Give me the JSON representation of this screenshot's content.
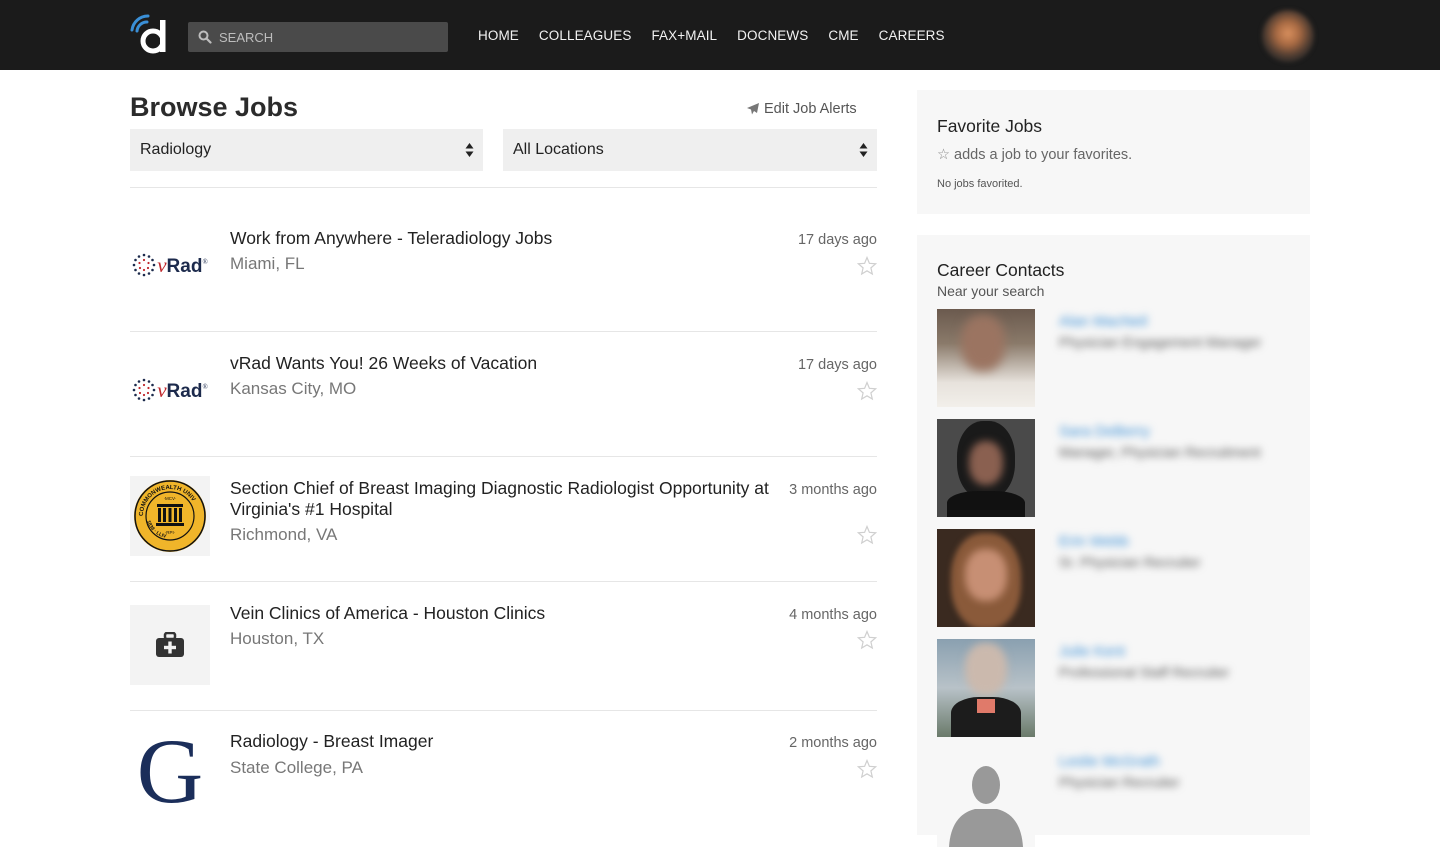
{
  "header": {
    "search_placeholder": "SEARCH",
    "nav": [
      "HOME",
      "COLLEAGUES",
      "FAX+MAIL",
      "DOCNEWS",
      "CME",
      "CAREERS"
    ]
  },
  "main": {
    "title": "Browse Jobs",
    "edit_alerts": "Edit Job Alerts",
    "specialty_filter": "Radiology",
    "location_filter": "All Locations",
    "jobs": [
      {
        "title": "Work from Anywhere - Teleradiology Jobs",
        "location": "Miami, FL",
        "posted": "17 days ago",
        "logo": "vrad-logo"
      },
      {
        "title": "vRad Wants You! 26 Weeks of Vacation",
        "location": "Kansas City, MO",
        "posted": "17 days ago",
        "logo": "vrad-logo"
      },
      {
        "title": "Section Chief of Breast Imaging Diagnostic Radiologist Opportunity at Virginia's #1 Hospital",
        "location": "Richmond, VA",
        "posted": "3 months ago",
        "logo": "vcu-seal-logo"
      },
      {
        "title": "Vein Clinics of America - Houston Clinics",
        "location": "Houston, TX",
        "posted": "4 months ago",
        "logo": "medical-bag-icon"
      },
      {
        "title": "Radiology - Breast Imager",
        "location": "State College, PA",
        "posted": "2 months ago",
        "logo": "g-logo"
      }
    ]
  },
  "vrad_logo": {
    "v": "v",
    "rad": "Rad",
    "reg": "®"
  },
  "vcu_seal": {
    "top": "COMMONWEALTH UNIV",
    "left": "VIRGINIA",
    "mid_top": "·MCV·",
    "mid_bottom": "·RPI·",
    "bottom": "1838 · LLIV"
  },
  "g_logo_letter": "G",
  "sidebar": {
    "favorites": {
      "title": "Favorite Jobs",
      "note": "adds a job to your favorites.",
      "empty": "No jobs favorited."
    },
    "contacts": {
      "title": "Career Contacts",
      "subtitle": "Near your search",
      "people": [
        {
          "name": "Alan MacNeil",
          "role": "Physician Engagement Manager"
        },
        {
          "name": "Sara DeBerry",
          "role": "Manager, Physician Recruitment"
        },
        {
          "name": "Erin Webb",
          "role": "Sr. Physician Recruiter"
        },
        {
          "name": "Julie Kent",
          "role": "Professional Staff Recruiter"
        },
        {
          "name": "Leslie McGrath",
          "role": "Physician Recruiter"
        }
      ]
    }
  },
  "colors": {
    "topbar": "#1b1b1b",
    "link": "#3a8fd6",
    "navy": "#1b2e5a",
    "vrad_red": "#c0282d"
  }
}
